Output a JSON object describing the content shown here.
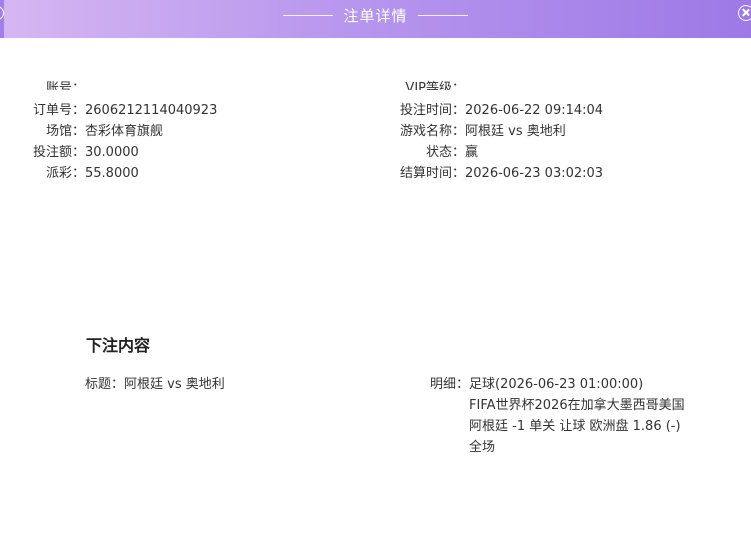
{
  "header": {
    "title": "注单详情"
  },
  "info": {
    "left": [
      {
        "label": "账号：",
        "value": "••••••••"
      },
      {
        "label": "订单号：",
        "value": "2606212114040923"
      },
      {
        "label": "场馆：",
        "value": "杏彩体育旗舰"
      },
      {
        "label": "投注额：",
        "value": "30.0000"
      },
      {
        "label": "派彩：",
        "value": "55.8000"
      }
    ],
    "right": [
      {
        "label": "VIP等级：",
        "value": "••"
      },
      {
        "label": "投注时间：",
        "value": "2026-06-22 09:14:04"
      },
      {
        "label": "游戏名称：",
        "value": "阿根廷 vs 奥地利"
      },
      {
        "label": "状态：",
        "value": "赢"
      },
      {
        "label": "结算时间：",
        "value": "2026-06-23 03:02:03"
      }
    ]
  },
  "bet_content": {
    "section_title": "下注内容",
    "title_label": "标题：",
    "title_value": "阿根廷 vs 奥地利",
    "detail_label": "明细：",
    "detail_lines": [
      "足球(2026-06-23 01:00:00)",
      "FIFA世界杯2026在加拿大墨西哥美国",
      "阿根廷 -1 单关 让球 欧洲盘 1.86 (-)",
      "全场"
    ]
  },
  "colors": {
    "header_gradient_start": "#d6b6f2",
    "header_gradient_end": "#9d79e6",
    "text": "#333333"
  }
}
